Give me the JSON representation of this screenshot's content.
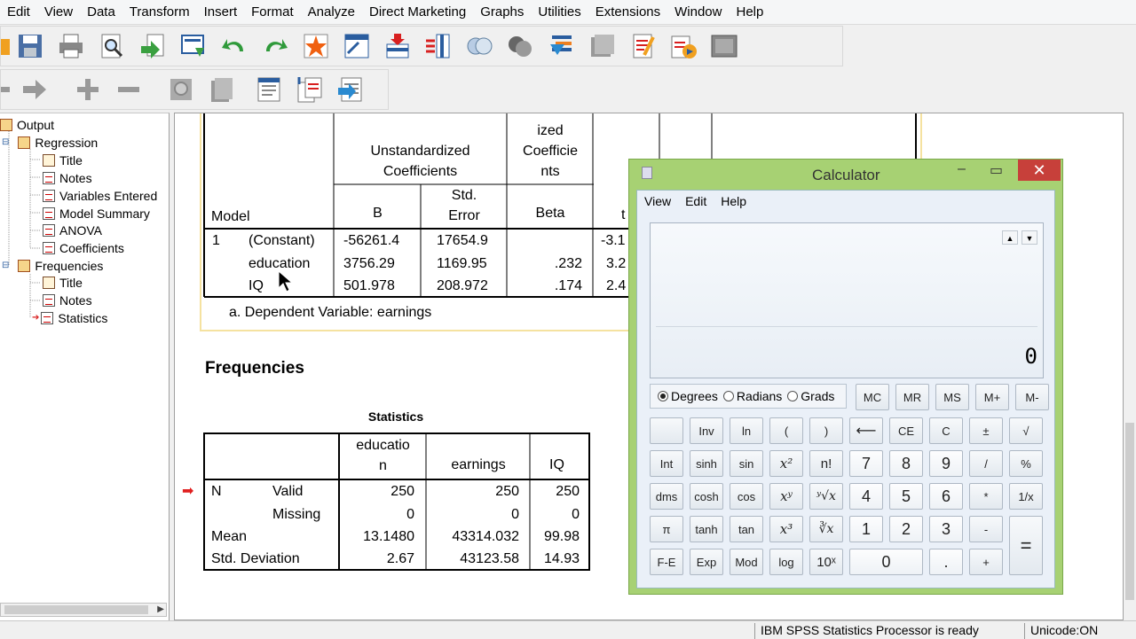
{
  "menu": [
    "Edit",
    "View",
    "Data",
    "Transform",
    "Insert",
    "Format",
    "Analyze",
    "Direct Marketing",
    "Graphs",
    "Utilities",
    "Extensions",
    "Window",
    "Help"
  ],
  "toolbar1_icons": [
    "open-icon",
    "save-icon",
    "print-icon",
    "print-preview-icon",
    "import-icon",
    "export-icon",
    "undo-icon",
    "redo-icon",
    "goto-case-icon",
    "goto-variable-icon",
    "insert-cases-icon",
    "variables-icon",
    "split-file-icon",
    "weight-cases-icon",
    "select-cases-icon",
    "value-labels-icon",
    "use-sets-icon",
    "show-all-icon",
    "spelling-icon",
    "designate-window-icon"
  ],
  "toolbar2_icons": [
    "back-icon",
    "forward-icon",
    "expand-icon",
    "collapse-icon",
    "show-icon",
    "hide-icon",
    "promote-icon",
    "demote-icon",
    "insert-heading-icon"
  ],
  "nav": {
    "output": "Output",
    "regression": "Regression",
    "reg_items": [
      "Title",
      "Notes",
      "Variables Entered",
      "Model Summary",
      "ANOVA",
      "Coefficients"
    ],
    "frequencies": "Frequencies",
    "freq_items": [
      "Title",
      "Notes",
      "Statistics"
    ]
  },
  "coef": {
    "h_unstd": [
      "Unstandardized",
      "Coefficients"
    ],
    "h_std": [
      "ized",
      "Coefficie",
      "nts"
    ],
    "h_model": "Model",
    "h_B": "B",
    "h_stderr": [
      "Std.",
      "Error"
    ],
    "h_beta": "Beta",
    "h_t": "t",
    "model_num": "1",
    "rows": [
      {
        "name": "(Constant)",
        "B": "-56261.4",
        "se": "17654.9",
        "beta": "",
        "t": "-3.1"
      },
      {
        "name": "education",
        "B": "3756.29",
        "se": "1169.95",
        "beta": ".232",
        "t": "3.2"
      },
      {
        "name": "IQ",
        "B": "501.978",
        "se": "208.972",
        "beta": ".174",
        "t": "2.4"
      }
    ],
    "footnote": "a. Dependent Variable: earnings"
  },
  "freq": {
    "heading": "Frequencies",
    "table_title": "Statistics",
    "col_headers": [
      [
        "educatio",
        "n"
      ],
      [
        "earnings"
      ],
      [
        "IQ"
      ]
    ],
    "rows": [
      {
        "l1": "N",
        "l2": "Valid",
        "v": [
          "250",
          "250",
          "250"
        ]
      },
      {
        "l1": "",
        "l2": "Missing",
        "v": [
          "0",
          "0",
          "0"
        ]
      },
      {
        "l1": "Mean",
        "l2": "",
        "v": [
          "13.1480",
          "43314.032",
          "99.98"
        ]
      },
      {
        "l1": "Std. Deviation",
        "l2": "",
        "v": [
          "2.67",
          "43123.58",
          "14.93"
        ]
      }
    ]
  },
  "calculator": {
    "title": "Calculator",
    "menus": [
      "View",
      "Edit",
      "Help"
    ],
    "display": "0",
    "angle_modes": [
      "Degrees",
      "Radians",
      "Grads"
    ],
    "memory_keys": [
      "MC",
      "MR",
      "MS",
      "M+",
      "M-"
    ],
    "keys": {
      "r1": [
        "",
        "Inv",
        "ln",
        "(",
        ")",
        "⟵",
        "CE",
        "C",
        "±",
        "√"
      ],
      "r2": [
        "Int",
        "sinh",
        "sin",
        "x²",
        "n!",
        "7",
        "8",
        "9",
        "/",
        "%"
      ],
      "r3": [
        "dms",
        "cosh",
        "cos",
        "xʸ",
        "ʸ√x",
        "4",
        "5",
        "6",
        "*",
        "1/x"
      ],
      "r4": [
        "π",
        "tanh",
        "tan",
        "x³",
        "∛x",
        "1",
        "2",
        "3",
        "-"
      ],
      "r5": [
        "F-E",
        "Exp",
        "Mod",
        "log",
        "10ˣ",
        "0",
        ".",
        "+"
      ],
      "eq": "="
    }
  },
  "status": {
    "processor": "IBM SPSS Statistics Processor is ready",
    "unicode": "Unicode:ON"
  }
}
